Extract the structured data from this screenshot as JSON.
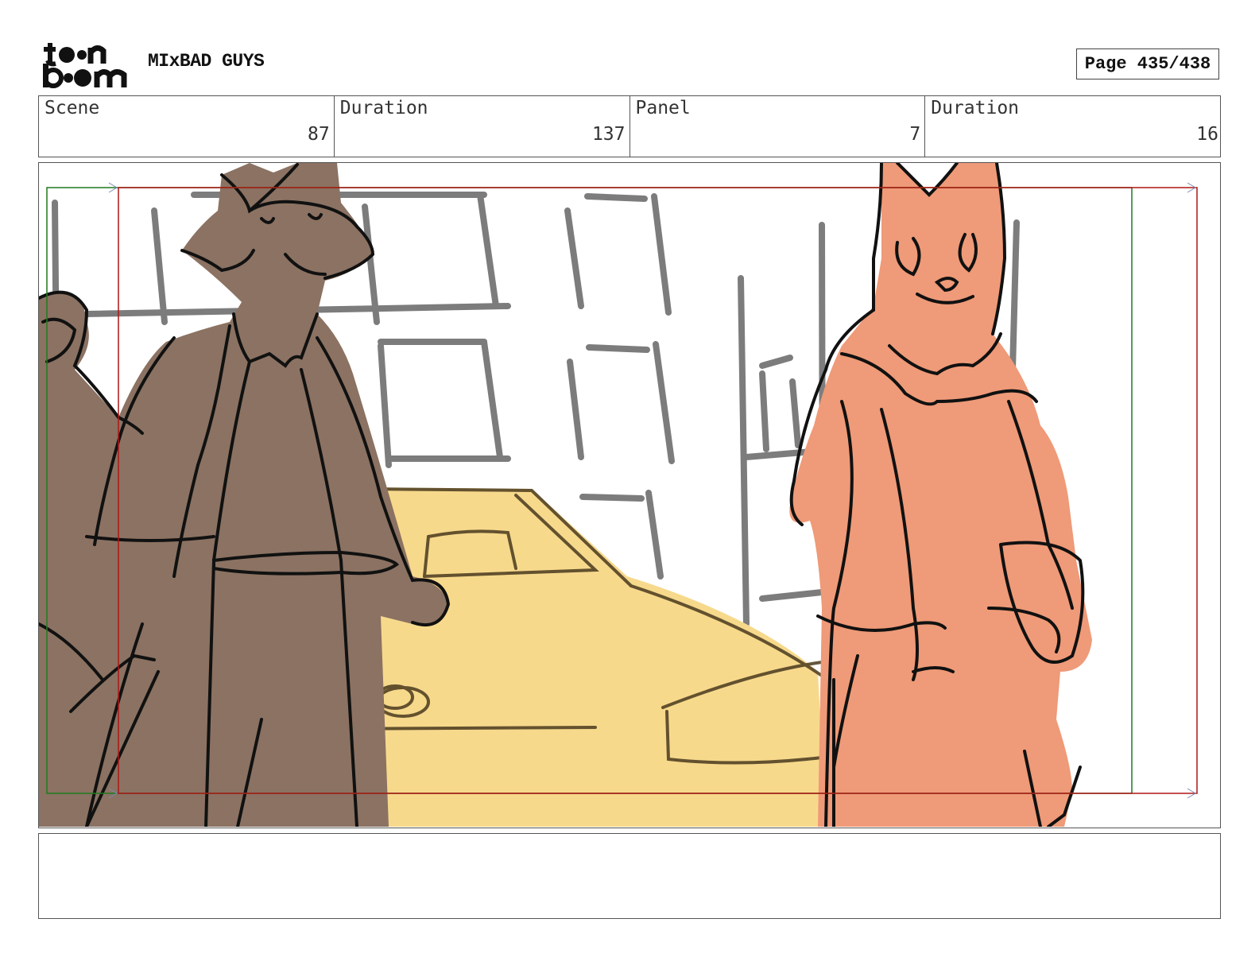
{
  "header": {
    "logo_text": "toon boom",
    "project_title": "MIxBAD GUYS",
    "page_label": "Page 435/438"
  },
  "info": {
    "scene_label": "Scene",
    "scene_value": "87",
    "scene_duration_label": "Duration",
    "scene_duration_value": "137",
    "panel_label": "Panel",
    "panel_value": "7",
    "panel_duration_label": "Duration",
    "panel_duration_value": "16"
  },
  "colors": {
    "wolf_fill": "#8b7262",
    "cat_fill": "#ef9a78",
    "car_fill": "#f7d98c",
    "safe_frame": "#b01515",
    "action_frame": "#1f7a1f"
  },
  "notes": {
    "text": ""
  }
}
